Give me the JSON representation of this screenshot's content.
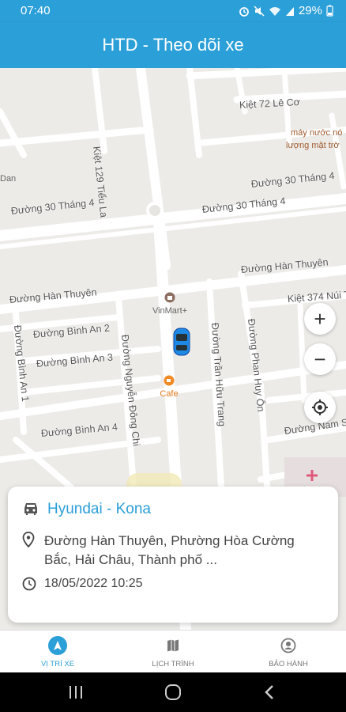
{
  "status_bar": {
    "time": "07:40",
    "battery": "29%"
  },
  "app_bar": {
    "title": "HTD - Theo dõi xe"
  },
  "map": {
    "streets": [
      "Kiệt 129 Tiểu La",
      "Kiệt 72 Lê Cơ",
      "Đường 30 Tháng 4",
      "Đường 30 Tháng 4",
      "Đường 30 Tháng 4",
      "Đường Hàn Thuyên",
      "Đường Hàn Thuyên",
      "Kiệt 374 Núi T",
      "Đường Bình An 2",
      "Đường Bình An 3",
      "Đường Bình An 1",
      "Đường Bình An 4",
      "Đường Nguyễn Đông Chi",
      "Đường Trần Hữu Trang",
      "Đường Phan Huy Ôn",
      "Đường Nam S"
    ],
    "pois": {
      "water_shop": "máy nước nó",
      "water_shop_2": "lượng mặt trờ",
      "left_edge": "Dan",
      "vinmart": "VinMart+",
      "cafe": "Cafe"
    },
    "controls": {
      "zoom_in": "+",
      "zoom_out": "−"
    }
  },
  "vehicle": {
    "name": "Hyundai - Kona",
    "address": "Đường Hàn Thuyên, Phường Hòa Cường Bắc, Hải Châu, Thành phố ...",
    "timestamp": "18/05/2022 10:25"
  },
  "bottom_nav": {
    "items": [
      {
        "label": "VỊ TRÍ XE",
        "icon": "location-arrow-icon",
        "active": true
      },
      {
        "label": "LỊCH TRÌNH",
        "icon": "map-icon",
        "active": false
      },
      {
        "label": "BẢO HÀNH",
        "icon": "warranty-icon",
        "active": false
      }
    ]
  },
  "colors": {
    "primary": "#2b9fd8",
    "map_bg": "#ecebe8",
    "road": "#ffffff"
  }
}
